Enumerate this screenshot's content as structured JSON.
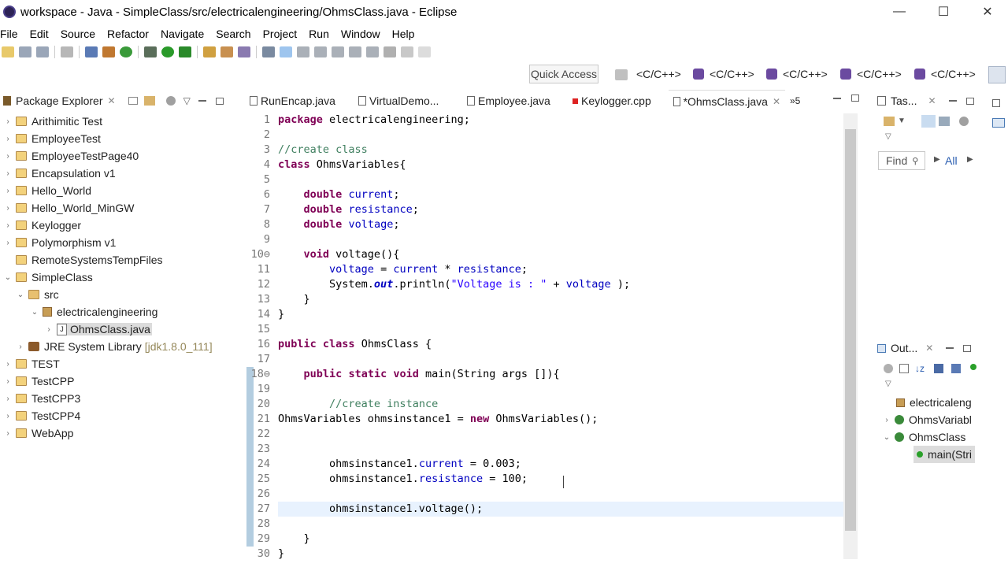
{
  "window": {
    "title": "workspace - Java - SimpleClass/src/electricalengineering/OhmsClass.java - Eclipse",
    "minimize": "—",
    "maximize": "☐",
    "close": "✕"
  },
  "menu": [
    "File",
    "Edit",
    "Source",
    "Refactor",
    "Navigate",
    "Search",
    "Project",
    "Run",
    "Window",
    "Help"
  ],
  "quick_access": "Quick Access",
  "perspectives": [
    "<C/C++>",
    "<C/C++>",
    "<C/C++>",
    "<C/C++>",
    "<C/C++>"
  ],
  "package_explorer": {
    "title": "Package Explorer",
    "items": [
      {
        "label": "Arithimitic Test",
        "twisty": "›",
        "icon": "project-icon"
      },
      {
        "label": "EmployeeTest",
        "twisty": "›",
        "icon": "project-icon"
      },
      {
        "label": "EmployeeTestPage40",
        "twisty": "›",
        "icon": "project-icon"
      },
      {
        "label": "Encapsulation v1",
        "twisty": "›",
        "icon": "project-icon"
      },
      {
        "label": "Hello_World",
        "twisty": "›",
        "icon": "project-icon"
      },
      {
        "label": "Hello_World_MinGW",
        "twisty": "›",
        "icon": "project-icon"
      },
      {
        "label": "Keylogger",
        "twisty": "›",
        "icon": "project-icon"
      },
      {
        "label": "Polymorphism v1",
        "twisty": "›",
        "icon": "project-icon"
      },
      {
        "label": "RemoteSystemsTempFiles",
        "twisty": "",
        "icon": "project-icon"
      },
      {
        "label": "SimpleClass",
        "twisty": "⌄",
        "icon": "project-icon"
      },
      {
        "label": "src",
        "twisty": "⌄",
        "icon": "source-folder-icon"
      },
      {
        "label": "electricalengineering",
        "twisty": "⌄",
        "icon": "package-icon"
      },
      {
        "label": "OhmsClass.java",
        "twisty": "›",
        "icon": "java-file-icon"
      },
      {
        "label": "JRE System Library",
        "suffix": "[jdk1.8.0_111]",
        "twisty": "›",
        "icon": "library-icon"
      },
      {
        "label": "TEST",
        "twisty": "›",
        "icon": "project-icon"
      },
      {
        "label": "TestCPP",
        "twisty": "›",
        "icon": "project-icon"
      },
      {
        "label": "TestCPP3",
        "twisty": "›",
        "icon": "project-icon"
      },
      {
        "label": "TestCPP4",
        "twisty": "›",
        "icon": "project-icon"
      },
      {
        "label": "WebApp",
        "twisty": "›",
        "icon": "project-icon"
      }
    ]
  },
  "editor_tabs": [
    {
      "label": "RunEncap.java"
    },
    {
      "label": "VirtualDemo..."
    },
    {
      "label": "Employee.java"
    },
    {
      "label": "Keylogger.cpp"
    },
    {
      "label": "*OhmsClass.java",
      "active": true
    }
  ],
  "overflow_tabs": "»5",
  "code_lines": [
    "package electricalengineering;",
    "",
    "//create class",
    "class OhmsVariables{",
    "",
    "    double current;",
    "    double resistance;",
    "    double voltage;",
    "",
    "    void voltage(){",
    "        voltage = current * resistance;",
    "        System.out.println(\"Voltage is : \" + voltage );",
    "    }",
    "}",
    "",
    "public class OhmsClass {",
    "",
    "    public static void main(String args []){",
    "",
    "        //create instance",
    "OhmsVariables ohmsinstance1 = new OhmsVariables();",
    "",
    "",
    "        ohmsinstance1.current = 0.003;",
    "        ohmsinstance1.resistance = 100;",
    "",
    "        ohmsinstance1.voltage();",
    "",
    "    }",
    "}"
  ],
  "tasks": {
    "title": "Tas...",
    "find_placeholder": "Find",
    "all_label": "All"
  },
  "outline": {
    "title": "Out...",
    "items": [
      {
        "label": "electricaleng"
      },
      {
        "label": "OhmsVariabl"
      },
      {
        "label": "OhmsClass"
      },
      {
        "label": "main(Stri"
      }
    ]
  }
}
